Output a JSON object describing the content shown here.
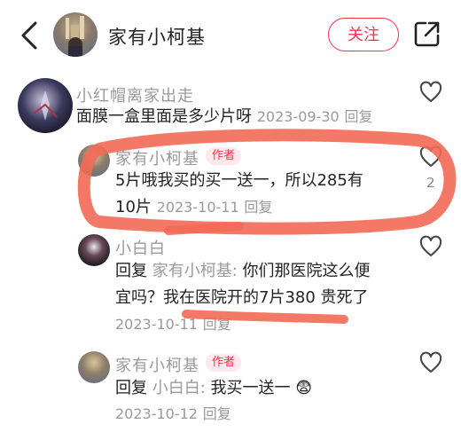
{
  "header": {
    "author_name": "家有小柯基",
    "follow_label": "关注"
  },
  "comments": [
    {
      "user": "小红帽离家出走",
      "text": "面膜一盒里面是多少片呀",
      "date": "2023-09-30",
      "reply_label": "回复"
    },
    {
      "user": "家有小柯基",
      "badge": "作者",
      "text_line1": "5片哦我买的买一送一，所以285有",
      "text_line2": "10片",
      "date": "2023-10-11",
      "reply_label": "回复",
      "likes": "2"
    },
    {
      "user": "小白白",
      "reply_prefix": "回复",
      "reply_to": "家有小柯基:",
      "text_line1": "你们那医院这么便",
      "text_line2": "宜吗？我在医院开的7片380  贵死了",
      "date": "2023-10-11",
      "reply_label": "回复"
    },
    {
      "user": "家有小柯基",
      "badge": "作者",
      "reply_prefix": "回复",
      "reply_to": "小白白:",
      "text": "我买一送一",
      "emoji": "😨",
      "date": "2023-10-12",
      "reply_label": "回复"
    }
  ],
  "colors": {
    "accent": "#ff2d50",
    "markup_stroke": "#f26a55"
  }
}
